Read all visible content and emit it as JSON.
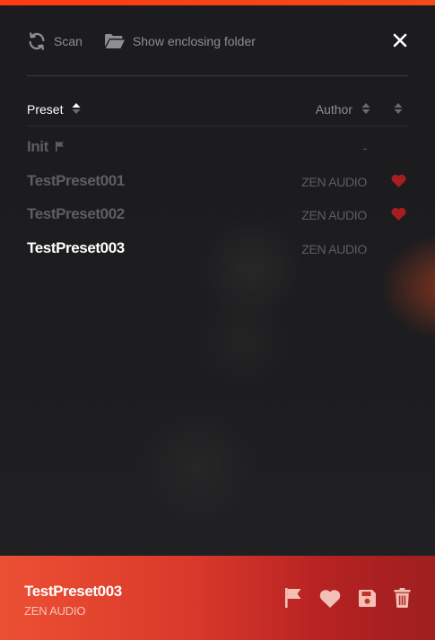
{
  "toolbar": {
    "scan_label": "Scan",
    "folder_label": "Show enclosing folder"
  },
  "columns": {
    "preset": "Preset",
    "author": "Author"
  },
  "presets": [
    {
      "name": "Init",
      "author": "-",
      "favorite": false,
      "flagged": true,
      "selected": false
    },
    {
      "name": "TestPreset001",
      "author": "ZEN AUDIO",
      "favorite": true,
      "flagged": false,
      "selected": false
    },
    {
      "name": "TestPreset002",
      "author": "ZEN AUDIO",
      "favorite": true,
      "flagged": false,
      "selected": false
    },
    {
      "name": "TestPreset003",
      "author": "ZEN AUDIO",
      "favorite": false,
      "flagged": false,
      "selected": true
    }
  ],
  "current": {
    "name": "TestPreset003",
    "author": "ZEN AUDIO"
  },
  "colors": {
    "accent": "#ff3a14",
    "favorite": "#a61e22",
    "footer_start": "#ec5033",
    "footer_end": "#9e1f1f",
    "text_dim": "#5e5e62",
    "text_bright": "#ffffff"
  },
  "icons": {
    "scan": "refresh-icon",
    "folder": "folder-open-icon",
    "close": "close-icon",
    "sort": "sort-icon",
    "favorite": "heart-icon",
    "flag": "flag-icon",
    "save": "save-icon",
    "delete": "trash-icon"
  }
}
